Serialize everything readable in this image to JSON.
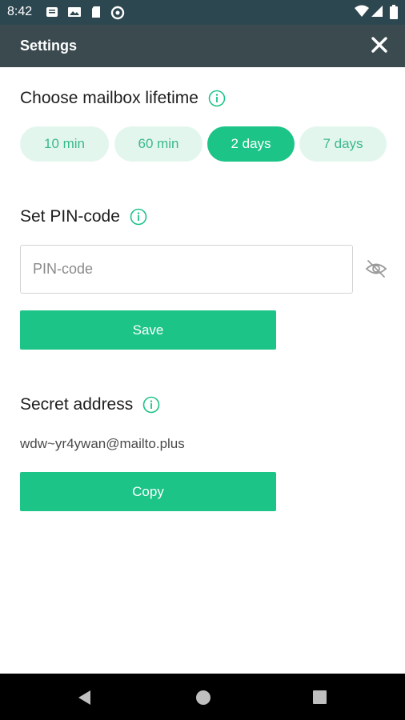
{
  "status_bar": {
    "time": "8:42"
  },
  "app_bar": {
    "title": "Settings"
  },
  "lifetime": {
    "title": "Choose mailbox lifetime",
    "options": [
      "10 min",
      "60 min",
      "2 days",
      "7 days"
    ],
    "selected": "2 days"
  },
  "pin": {
    "title": "Set PIN-code",
    "placeholder": "PIN-code",
    "value": "",
    "save_label": "Save"
  },
  "secret": {
    "title": "Secret address",
    "address": "wdw~yr4ywan@mailto.plus",
    "copy_label": "Copy"
  },
  "colors": {
    "accent": "#1dc487",
    "accent_light": "#e3f6ee",
    "app_bar": "#3a4a4f"
  }
}
